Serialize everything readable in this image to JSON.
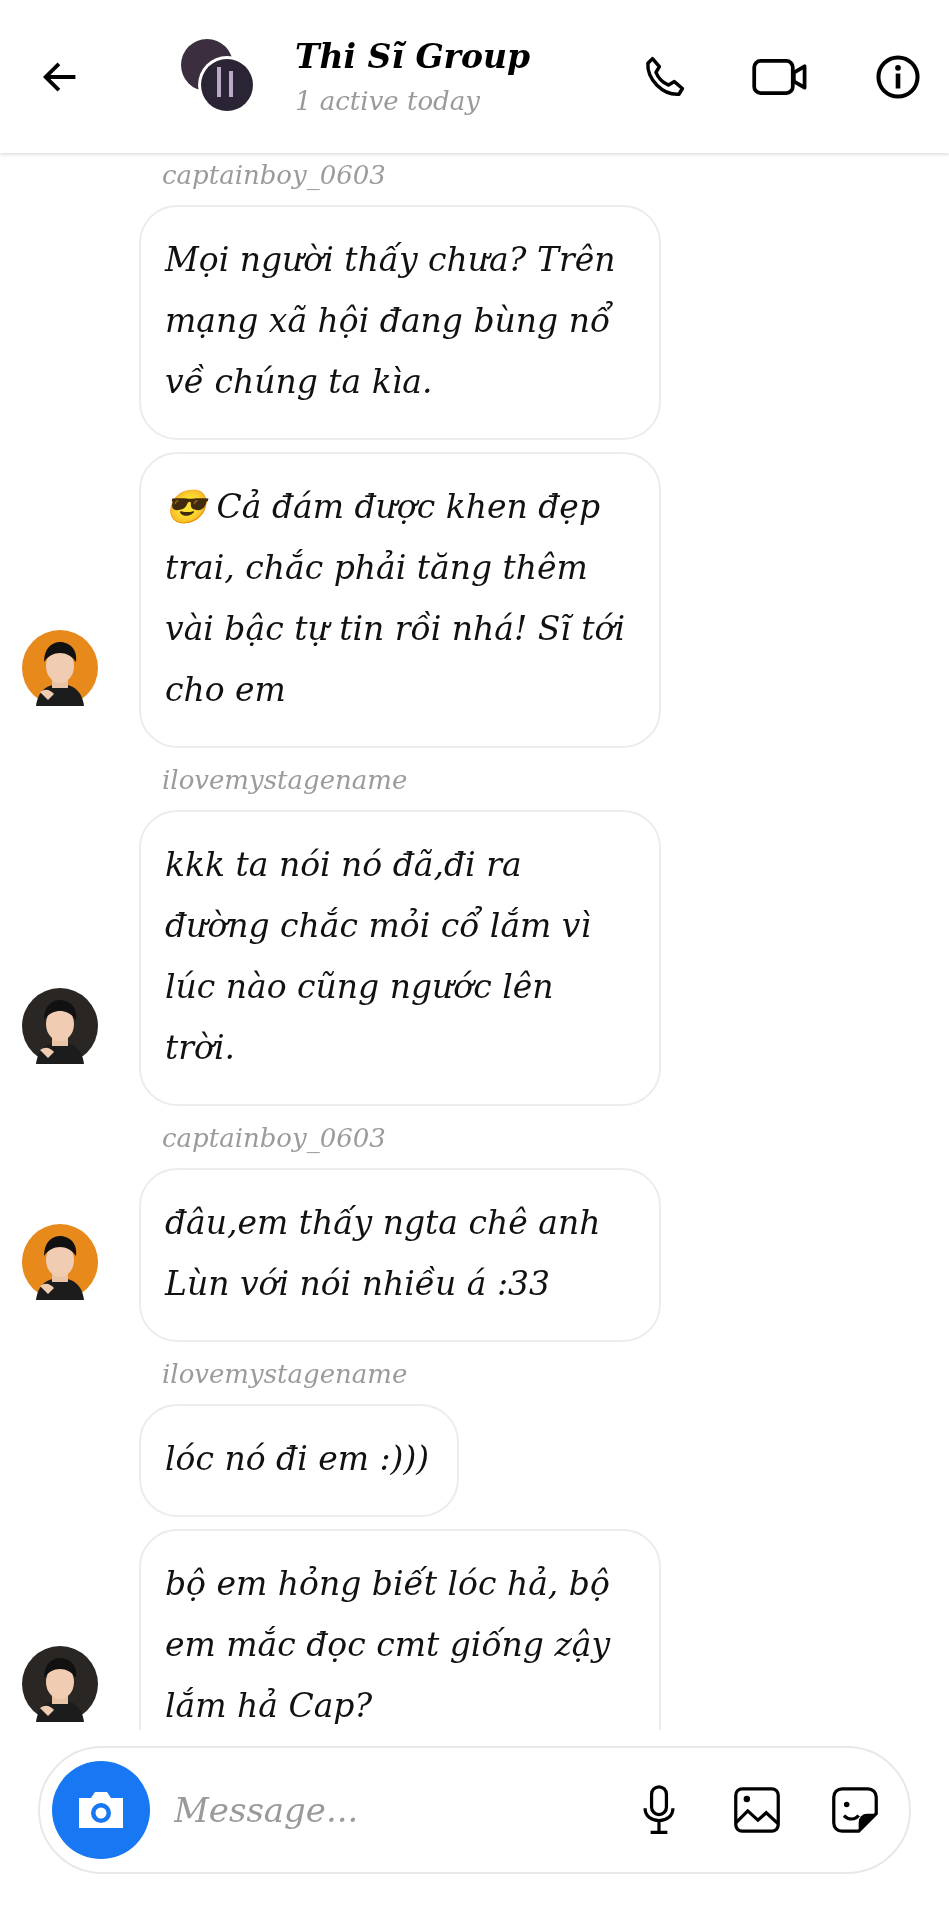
{
  "header": {
    "title": "Thi Sĩ Group",
    "status": "1 active today"
  },
  "groups": [
    {
      "sender": "captainboy_0603",
      "color": "#e8891c",
      "messages": [
        "Mọi người thấy chưa? Trên mạng xã hội đang bùng nổ về chúng ta kìa.",
        "😎 Cả đám được khen đẹp trai, chắc phải tăng thêm vài bậc tự tin rồi nhá! Sĩ tới cho em"
      ]
    },
    {
      "sender": "ilovemystagename",
      "color": "#2a2624",
      "messages": [
        " kkk ta nói nó đã,đi ra đường chắc mỏi cổ lắm vì lúc nào cũng ngước lên trời."
      ]
    },
    {
      "sender": "captainboy_0603",
      "color": "#e8891c",
      "messages": [
        "đâu,em thấy ngta chê anh Lùn với nói nhiều á :33"
      ]
    },
    {
      "sender": "ilovemystagename",
      "color": "#2a2624",
      "messages": [
        "lóc nó đi em :)))",
        "bộ em hỏng biết lóc hả, bộ em mắc đọc cmt giống zậy lắm hả Cap?"
      ]
    }
  ],
  "composer": {
    "placeholder": "Message..."
  }
}
